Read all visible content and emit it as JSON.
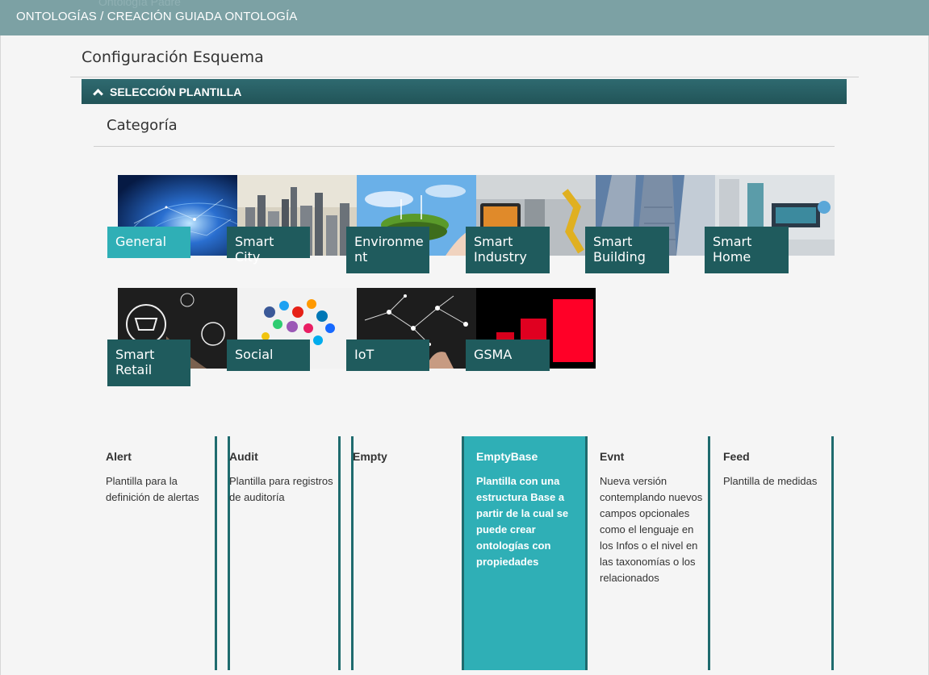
{
  "header": {
    "ghost_text": "Ontología Padre",
    "title": "ONTOLOGÍAS / CREACIÓN GUIADA ONTOLOGÍA"
  },
  "main": {
    "section_title": "Configuración Esquema",
    "panel_title": "SELECCIÓN PLANTILLA",
    "category_title": "Categoría"
  },
  "categories": [
    {
      "label": "General",
      "icon": "globe-network-image",
      "active": true
    },
    {
      "label": "Smart City",
      "icon": "city-skyline-image"
    },
    {
      "label": "Environme nt",
      "icon": "earth-wind-turbines-image"
    },
    {
      "label": "Smart Industry",
      "icon": "industrial-robot-image"
    },
    {
      "label": "Smart Building",
      "icon": "skyscrapers-image"
    },
    {
      "label": "Smart Home",
      "icon": "smart-home-interior-image"
    },
    {
      "label": "Smart Retail",
      "icon": "shopping-cart-image"
    },
    {
      "label": "Social",
      "icon": "social-media-icons-image"
    },
    {
      "label": "IoT",
      "icon": "iot-network-hand-image"
    },
    {
      "label": "GSMA",
      "icon": "red-bars-image"
    }
  ],
  "templates": [
    {
      "name": "Alert",
      "description": "Plantilla para la definición de alertas"
    },
    {
      "name": "Audit",
      "description": "Plantilla para registros de auditoría"
    },
    {
      "name": "Empty",
      "description": ""
    },
    {
      "name": "EmptyBase",
      "description": "Plantilla con una estructura Base a partir de la cual se puede crear ontologías con propiedades",
      "selected": true
    },
    {
      "name": "Evnt",
      "description": "Nueva versión contemplando nuevos campos opcionales como el lenguaje en los Infos o el nivel en las taxonomías o los relacionados"
    },
    {
      "name": "Feed",
      "description": "Plantilla de medidas"
    }
  ],
  "colors": {
    "header_bg": "#7ca1a4",
    "panel_header": "#215458",
    "label_bg": "#1f5b5d",
    "accent": "#2fafb6"
  }
}
